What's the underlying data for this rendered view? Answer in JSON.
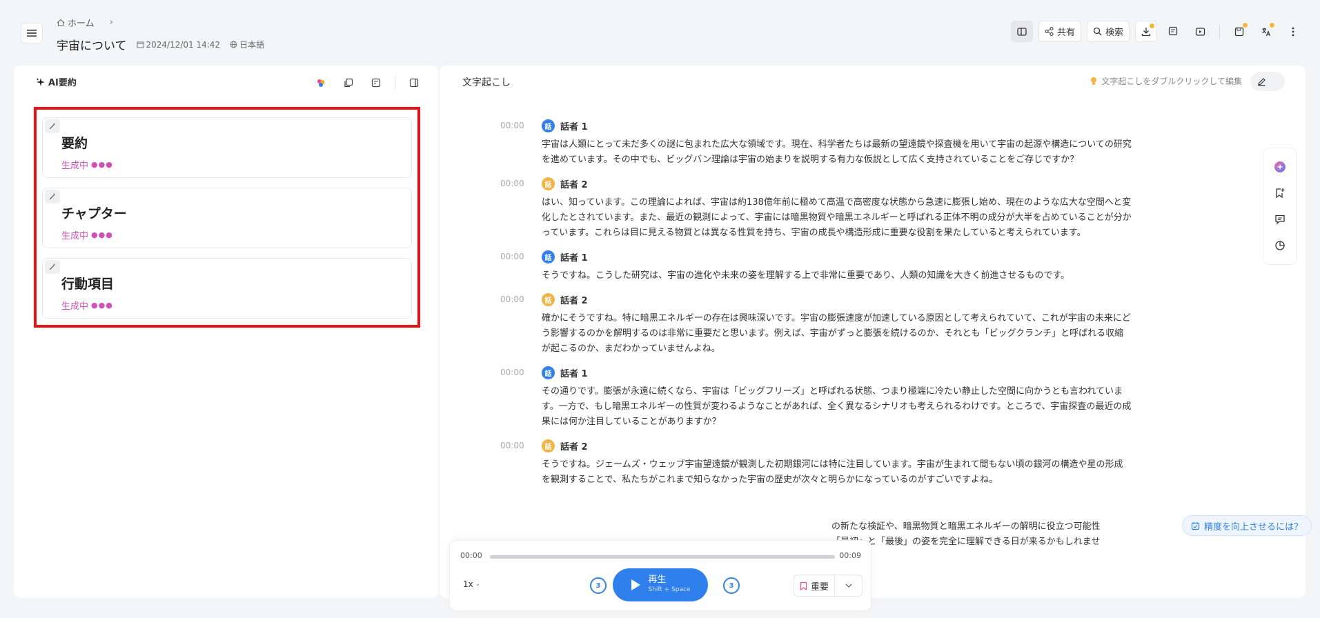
{
  "header": {
    "breadcrumb_home": "ホーム",
    "title": "宇宙について",
    "date": "2024/12/01 14:42",
    "language": "日本語",
    "share_label": "共有",
    "search_label": "検索"
  },
  "summary_panel": {
    "title": "AI要約",
    "cards": [
      {
        "title": "要約",
        "status": "生成中"
      },
      {
        "title": "チャプター",
        "status": "生成中"
      },
      {
        "title": "行動項目",
        "status": "生成中"
      }
    ]
  },
  "transcript_panel": {
    "title": "文字起こし",
    "hint": "文字起こしをダブルクリックして編集",
    "entries": [
      {
        "time": "00:00",
        "speaker": "話者 1",
        "avatar": "話",
        "text": "宇宙は人類にとって未だ多くの謎に包まれた広大な領域です。現在、科学者たちは最新の望遠鏡や探査機を用いて宇宙の起源や構造についての研究を進めています。その中でも、ビッグバン理論は宇宙の始まりを説明する有力な仮説として広く支持されていることをご存じですか？"
      },
      {
        "time": "00:00",
        "speaker": "話者 2",
        "avatar": "話",
        "text": "はい、知っています。この理論によれば、宇宙は約138億年前に極めて高温で高密度な状態から急速に膨張し始め、現在のような広大な空間へと変化したとされています。また、最近の観測によって、宇宙には暗黒物質や暗黒エネルギーと呼ばれる正体不明の成分が大半を占めていることが分かっています。これらは目に見える物質とは異なる性質を持ち、宇宙の成長や構造形成に重要な役割を果たしていると考えられています。"
      },
      {
        "time": "00:00",
        "speaker": "話者 1",
        "avatar": "話",
        "text": "そうですね。こうした研究は、宇宙の進化や未来の姿を理解する上で非常に重要であり、人類の知識を大きく前進させるものです。"
      },
      {
        "time": "00:00",
        "speaker": "話者 2",
        "avatar": "話",
        "text": "確かにそうですね。特に暗黒エネルギーの存在は興味深いです。宇宙の膨張速度が加速している原因として考えられていて、これが宇宙の未来にどう影響するのかを解明するのは非常に重要だと思います。例えば、宇宙がずっと膨張を続けるのか、それとも「ビッグクランチ」と呼ばれる収縮が起こるのか、まだわかっていませんよね。"
      },
      {
        "time": "00:00",
        "speaker": "話者 1",
        "avatar": "話",
        "text": "その通りです。膨張が永遠に続くなら、宇宙は「ビッグフリーズ」と呼ばれる状態、つまり極端に冷たい静止した空間に向かうとも言われています。一方で、もし暗黒エネルギーの性質が変わるようなことがあれば、全く異なるシナリオも考えられるわけです。ところで、宇宙探査の最近の成果には何か注目していることがありますか？"
      },
      {
        "time": "00:00",
        "speaker": "話者 2",
        "avatar": "話",
        "text": "そうですね。ジェームズ・ウェッブ宇宙望遠鏡が観測した初期銀河には特に注目しています。宇宙が生まれて間もない頃の銀河の構造や星の形成を観測することで、私たちがこれまで知らなかった宇宙の歴史が次々と明らかになっているのがすごいですよね。"
      }
    ],
    "partial_line_1": "の新たな検証や、暗黒物質と暗黒エネルギーの解明に役立つ可能性",
    "partial_line_2": "「最初」と「最後」の姿を完全に理解できる日が来るかもしれませ"
  },
  "accuracy_button": "精度を向上させるには？",
  "player": {
    "current_time": "00:00",
    "total_time": "00:09",
    "progress": 0,
    "speed": "1x",
    "skip_back": "3",
    "skip_forward": "3",
    "play_label": "再生",
    "play_shortcut": "Shift + Space",
    "important_label": "重要"
  },
  "colors": {
    "accent": "#2f80ed",
    "generating": "#d34fb5",
    "speaker1": "#2f80ed",
    "speaker2": "#f2b544",
    "highlight": "#ee1111"
  }
}
